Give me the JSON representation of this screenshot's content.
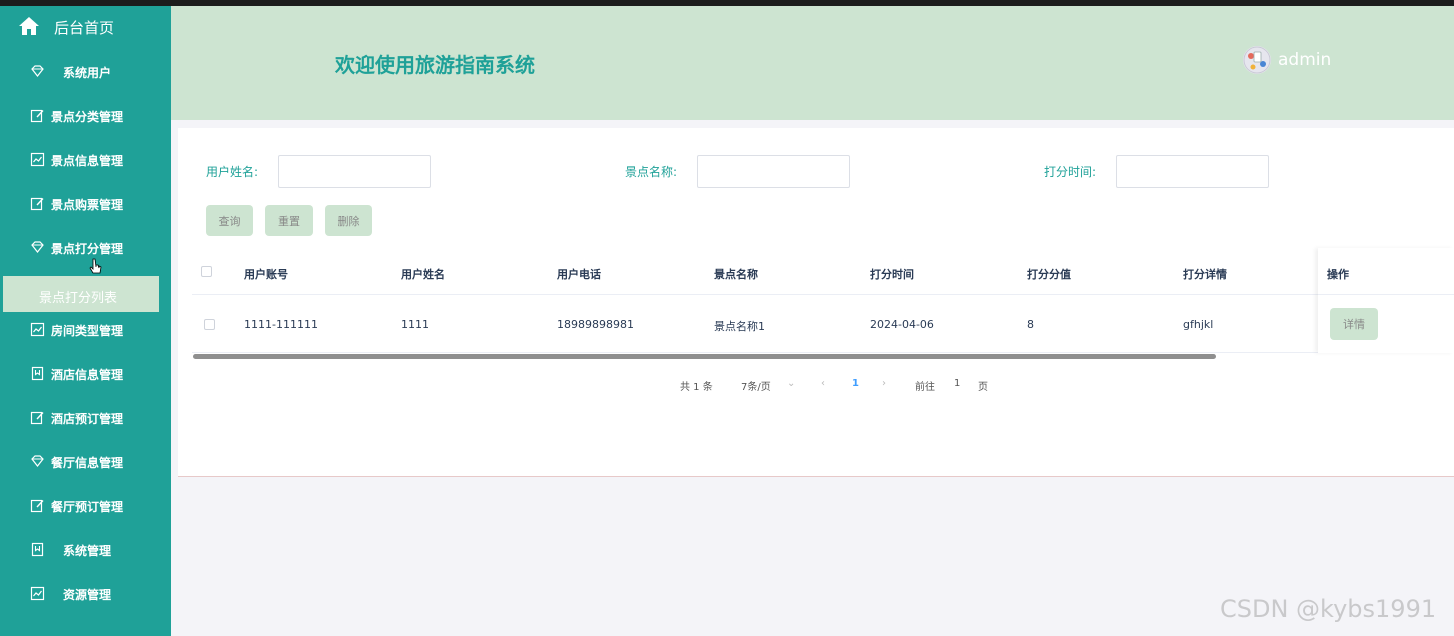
{
  "sidebar": {
    "home_label": "后台首页",
    "items": [
      {
        "label": "系统用户",
        "icon": "diamond-icon"
      },
      {
        "label": "景点分类管理",
        "icon": "edit-icon"
      },
      {
        "label": "景点信息管理",
        "icon": "chart-icon"
      },
      {
        "label": "景点购票管理",
        "icon": "edit-icon"
      },
      {
        "label": "景点打分管理",
        "icon": "diamond-icon"
      },
      {
        "label": "房间类型管理",
        "icon": "chart-icon"
      },
      {
        "label": "酒店信息管理",
        "icon": "bookmark-icon"
      },
      {
        "label": "酒店预订管理",
        "icon": "edit-icon"
      },
      {
        "label": "餐厅信息管理",
        "icon": "diamond-icon"
      },
      {
        "label": "餐厅预订管理",
        "icon": "edit-icon"
      },
      {
        "label": "系统管理",
        "icon": "bookmark-icon"
      },
      {
        "label": "资源管理",
        "icon": "chart-icon"
      }
    ],
    "active_sub": "景点打分列表"
  },
  "header": {
    "title": "欢迎使用旅游指南系统",
    "username": "admin"
  },
  "search": {
    "user_name_label": "用户姓名:",
    "user_name_value": "",
    "spot_name_label": "景点名称:",
    "spot_name_value": "",
    "score_time_label": "打分时间:",
    "score_time_value": ""
  },
  "buttons": {
    "query": "查询",
    "reset": "重置",
    "delete": "删除"
  },
  "table": {
    "headers": [
      "用户账号",
      "用户姓名",
      "用户电话",
      "景点名称",
      "打分时间",
      "打分分值",
      "打分详情"
    ],
    "op_header": "操作",
    "rows": [
      {
        "cells": [
          "1111-111111",
          "1111",
          "18989898981",
          "景点名称1",
          "2024-04-06",
          "8",
          "gfhjkl"
        ],
        "action": "详情"
      }
    ]
  },
  "pagination": {
    "total": "共 1 条",
    "page_size": "7条/页",
    "current_page": "1",
    "goto_label": "前往",
    "goto_value": "1",
    "page_suffix": "页"
  },
  "watermark": "CSDN @kybs1991",
  "colors": {
    "sidebar": "#1fa198",
    "header": "#cde4d1",
    "accent": "#1fa198",
    "button": "#cde4d1"
  }
}
